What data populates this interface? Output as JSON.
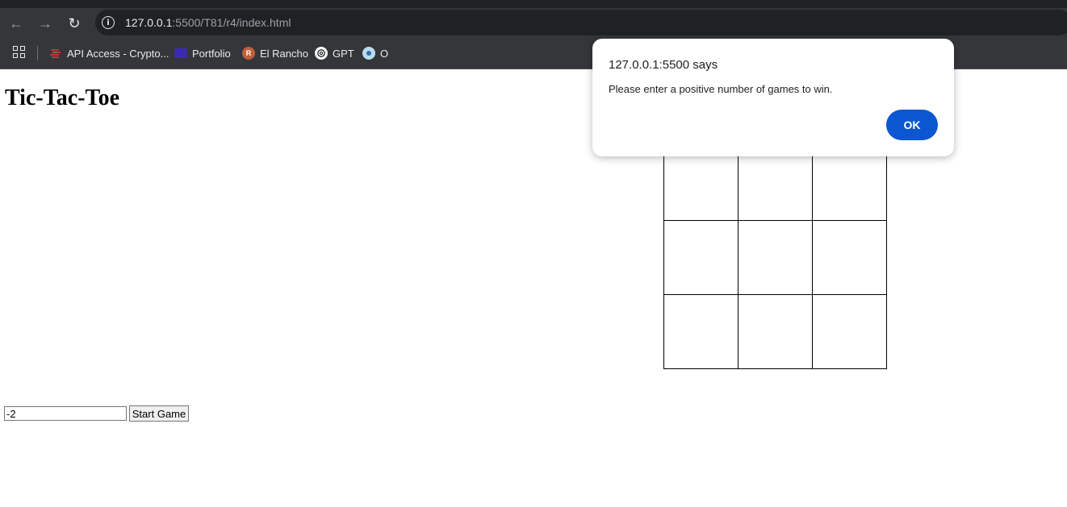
{
  "browser": {
    "url_host": "127.0.0.1",
    "url_rest": ":5500/T81/r4/index.html",
    "bookmarks": [
      {
        "label": "API Access - Crypto...",
        "icon": "chart-lines-icon"
      },
      {
        "label": "Portfolio",
        "icon": "portfolio-icon"
      },
      {
        "label": "El Rancho",
        "icon": "r-letter-icon",
        "icon_letter": "R"
      },
      {
        "label": "GPT",
        "icon": "openai-icon"
      },
      {
        "label": "O",
        "icon": "circle-logo-icon"
      }
    ]
  },
  "page": {
    "title": "Tic-Tac-Toe",
    "board": [
      "",
      "",
      "",
      "",
      "",
      "",
      "",
      "",
      ""
    ],
    "games_input_value": "-2",
    "start_button_label": "Start Game"
  },
  "dialog": {
    "title": "127.0.0.1:5500 says",
    "message": "Please enter a positive number of games to win.",
    "ok_label": "OK"
  },
  "colors": {
    "chrome_bg": "#35363a",
    "omnibox_bg": "#202124",
    "ok_button": "#0b57d0"
  }
}
